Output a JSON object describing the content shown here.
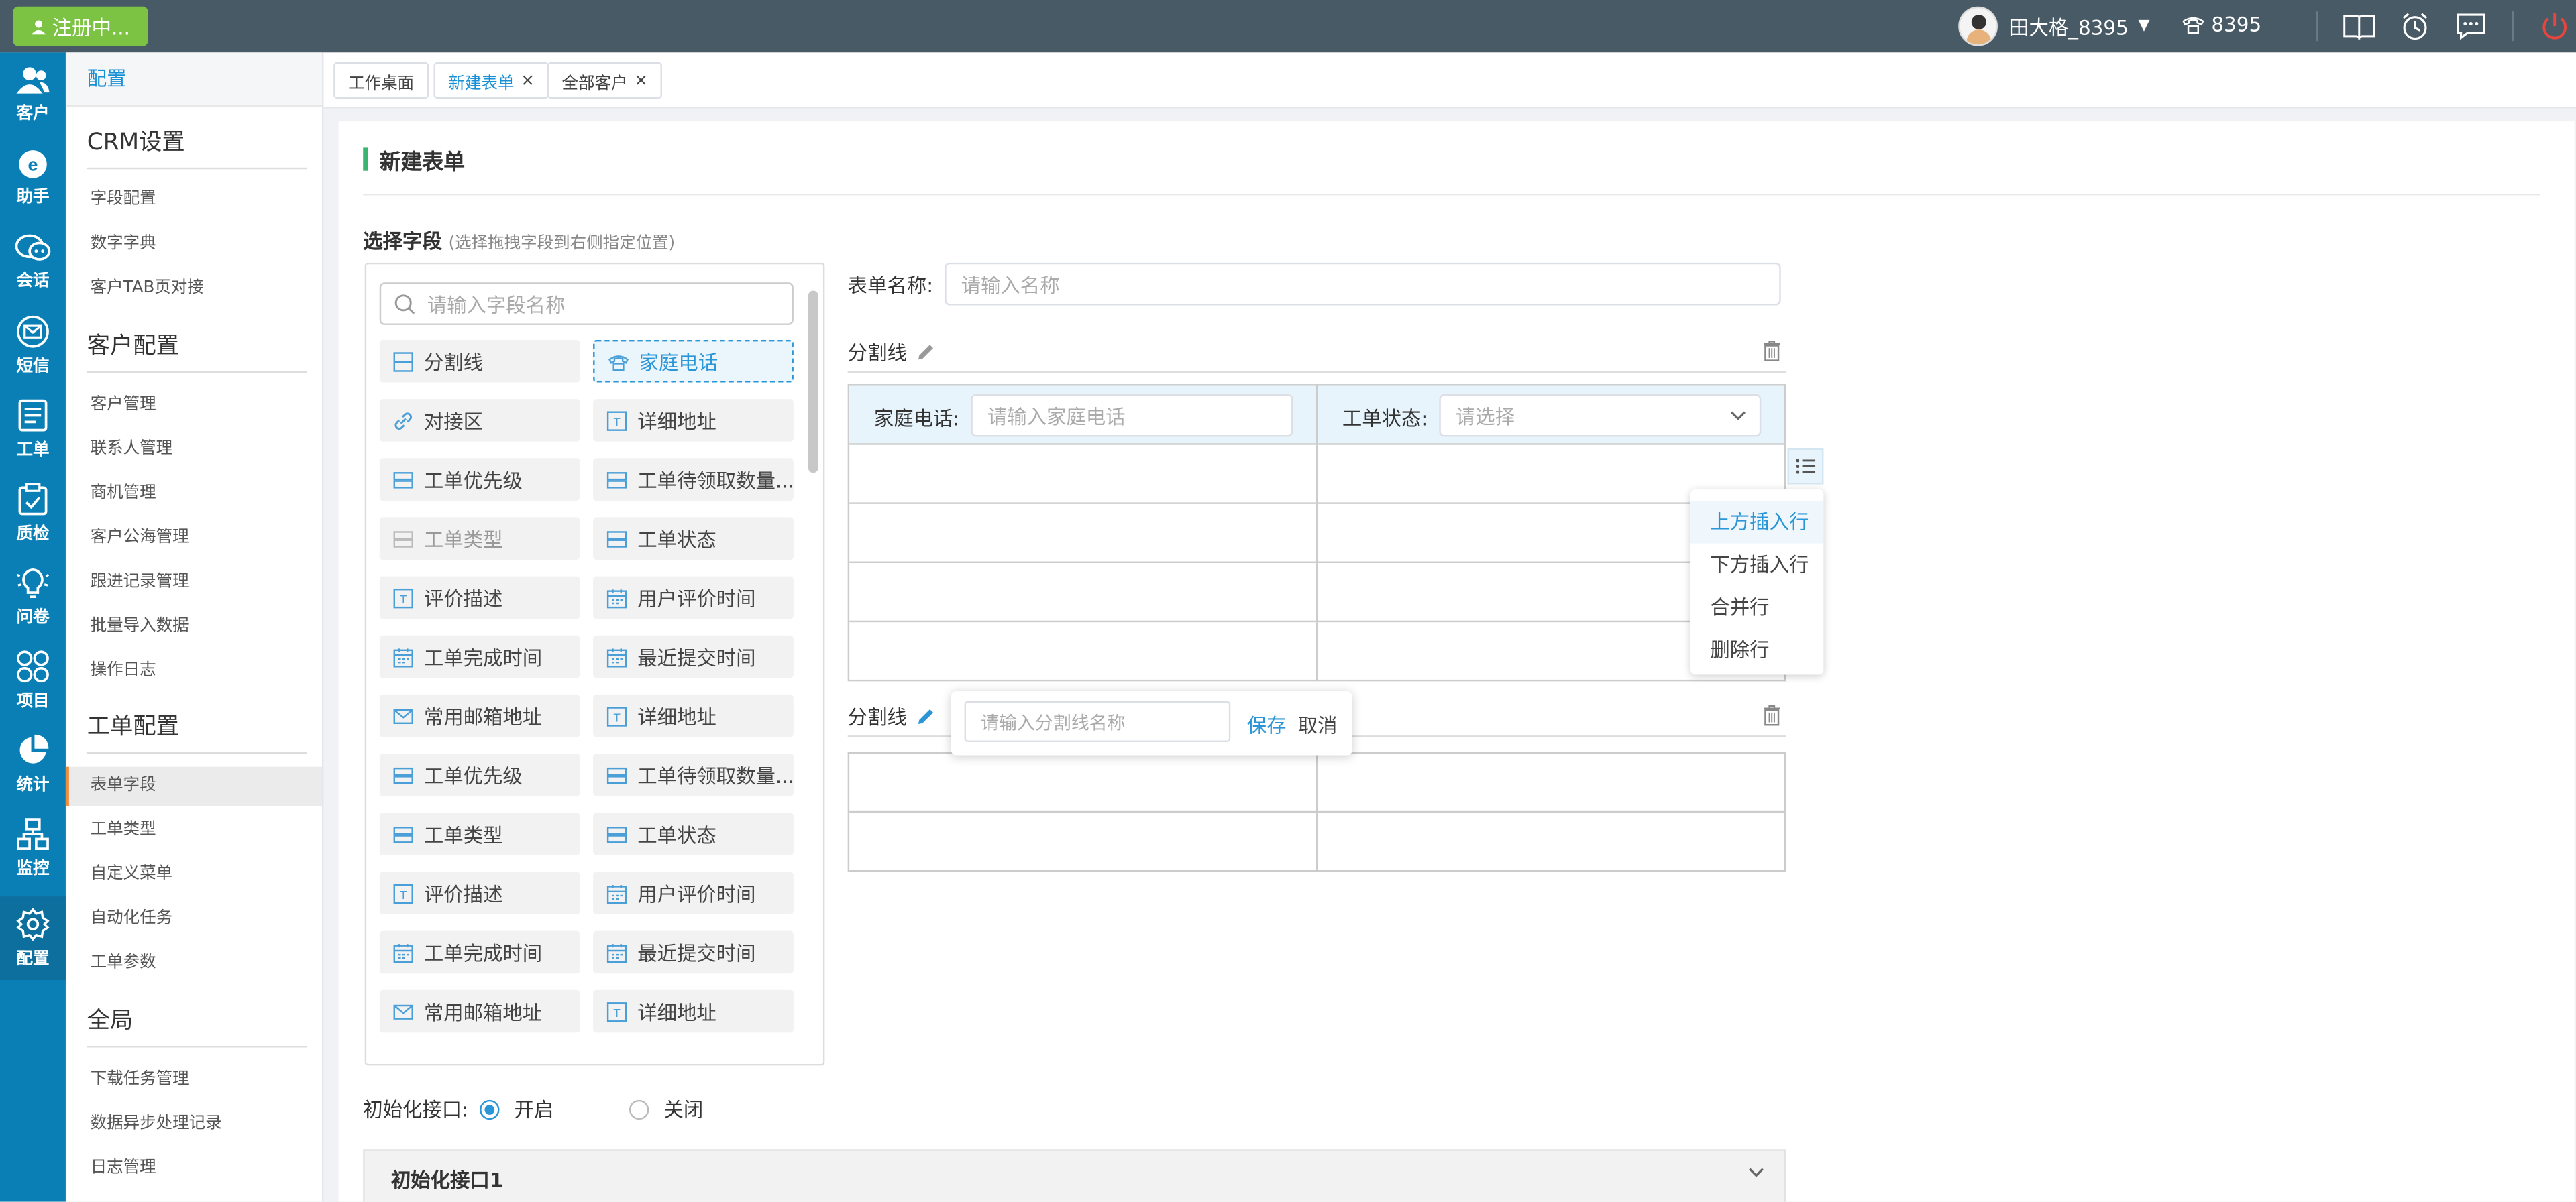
{
  "topbar": {
    "register_label": "注册中...",
    "user_name": "田大格_8395",
    "phone_ext": "8395",
    "icons": [
      "book-icon",
      "alarm-clock-icon",
      "message-icon",
      "power-icon"
    ],
    "colors": {
      "bar": "#485a66",
      "register": "#7cc344"
    }
  },
  "leftnav": {
    "items": [
      {
        "label": "客户",
        "icon": "customers-icon"
      },
      {
        "label": "助手",
        "icon": "assistant-icon"
      },
      {
        "label": "会话",
        "icon": "chat-icon"
      },
      {
        "label": "短信",
        "icon": "sms-icon"
      },
      {
        "label": "工单",
        "icon": "ticket-icon"
      },
      {
        "label": "质检",
        "icon": "quality-check-icon"
      },
      {
        "label": "问卷",
        "icon": "survey-icon"
      },
      {
        "label": "项目",
        "icon": "project-icon"
      },
      {
        "label": "统计",
        "icon": "statistics-icon"
      },
      {
        "label": "监控",
        "icon": "monitor-icon"
      },
      {
        "label": "配置",
        "icon": "settings-icon"
      }
    ],
    "active": "配置",
    "color": "#0a7fb5"
  },
  "submenu": {
    "header": "配置",
    "sections": [
      {
        "title": "CRM设置",
        "items": [
          "字段配置",
          "数字字典",
          "客户TAB页对接"
        ]
      },
      {
        "title": "客户配置",
        "items": [
          "客户管理",
          "联系人管理",
          "商机管理",
          "客户公海管理",
          "跟进记录管理",
          "批量导入数据",
          "操作日志"
        ]
      },
      {
        "title": "工单配置",
        "items": [
          "表单字段",
          "工单类型",
          "自定义菜单",
          "自动化任务",
          "工单参数"
        ]
      },
      {
        "title": "全局",
        "items": [
          "下载任务管理",
          "数据异步处理记录",
          "日志管理"
        ]
      }
    ],
    "active_item": "表单字段"
  },
  "tabs": [
    {
      "label": "工作桌面",
      "closable": false,
      "active": false
    },
    {
      "label": "新建表单",
      "closable": true,
      "active": true
    },
    {
      "label": "全部客户",
      "closable": true,
      "active": false
    }
  ],
  "main": {
    "title": "新建表单",
    "select_title": "选择字段",
    "select_hint": "(选择拖拽字段到右侧指定位置)",
    "search_placeholder": "请输入字段名称",
    "fields": [
      {
        "label": "分割线",
        "icon": "divider-icon",
        "state": "normal"
      },
      {
        "label": "家庭电话",
        "icon": "phone-icon",
        "state": "dragging"
      },
      {
        "label": "对接区",
        "icon": "link-icon",
        "state": "normal"
      },
      {
        "label": "详细地址",
        "icon": "text-field-icon",
        "state": "normal"
      },
      {
        "label": "工单优先级",
        "icon": "select-icon",
        "state": "normal"
      },
      {
        "label": "工单待领取数量...",
        "icon": "select-icon",
        "state": "normal"
      },
      {
        "label": "工单类型",
        "icon": "select-icon",
        "state": "disabled"
      },
      {
        "label": "工单状态",
        "icon": "select-icon",
        "state": "normal"
      },
      {
        "label": "评价描述",
        "icon": "text-field-icon",
        "state": "normal"
      },
      {
        "label": "用户评价时间",
        "icon": "calendar-icon",
        "state": "normal"
      },
      {
        "label": "工单完成时间",
        "icon": "calendar-icon",
        "state": "normal"
      },
      {
        "label": "最近提交时间",
        "icon": "calendar-icon",
        "state": "normal"
      },
      {
        "label": "常用邮箱地址",
        "icon": "mail-icon",
        "state": "normal"
      },
      {
        "label": "详细地址",
        "icon": "text-field-icon",
        "state": "normal"
      },
      {
        "label": "工单优先级",
        "icon": "select-icon",
        "state": "normal"
      },
      {
        "label": "工单待领取数量...",
        "icon": "select-icon",
        "state": "normal"
      },
      {
        "label": "工单类型",
        "icon": "select-icon",
        "state": "normal"
      },
      {
        "label": "工单状态",
        "icon": "select-icon",
        "state": "normal"
      },
      {
        "label": "评价描述",
        "icon": "text-field-icon",
        "state": "normal"
      },
      {
        "label": "用户评价时间",
        "icon": "calendar-icon",
        "state": "normal"
      },
      {
        "label": "工单完成时间",
        "icon": "calendar-icon",
        "state": "normal"
      },
      {
        "label": "最近提交时间",
        "icon": "calendar-icon",
        "state": "normal"
      },
      {
        "label": "常用邮箱地址",
        "icon": "mail-icon",
        "state": "normal"
      },
      {
        "label": "详细地址",
        "icon": "text-field-icon",
        "state": "normal"
      }
    ],
    "form_name_label": "表单名称:",
    "form_name_placeholder": "请输入名称",
    "divider1_label": "分割线",
    "home_phone_label": "家庭电话:",
    "home_phone_placeholder": "请输入家庭电话",
    "ticket_status_label": "工单状态:",
    "ticket_status_placeholder": "请选择",
    "context_menu": [
      "上方插入行",
      "下方插入行",
      "合并行",
      "删除行"
    ],
    "divider2_label": "分割线",
    "divider_name_placeholder": "请输入分割线名称",
    "save_label": "保存",
    "cancel_label": "取消",
    "init_label": "初始化接口:",
    "radio_on_label": "开启",
    "radio_off_label": "关闭",
    "init_value": "开启",
    "collapse_title": "初始化接口1",
    "accent": "#2a96d8"
  }
}
